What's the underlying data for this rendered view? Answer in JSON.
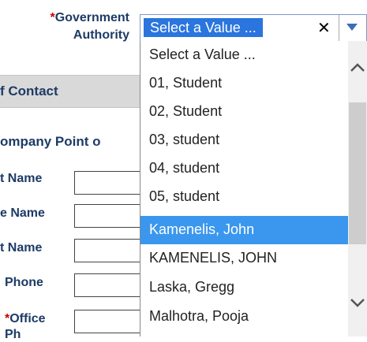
{
  "form": {
    "gov_label_req": "*",
    "gov_label_line1": "Government",
    "gov_label_line2": "Authority",
    "section_title": "f Contact",
    "subsection_title": "ompany Point o",
    "labels": {
      "first_name": "t Name",
      "middle_name": "e Name",
      "last_name": "t Name",
      "phone": "Phone",
      "office_req": "*",
      "office": "Office",
      "office_cut": "Ph"
    }
  },
  "select": {
    "value": "Select a Value ...",
    "clear_glyph": "✕",
    "options": [
      "Select a Value ...",
      "01, Student",
      "02, Student",
      "03, student",
      "04, student",
      "05, student",
      "Kamenelis, John",
      "KAMENELIS, JOHN",
      "Laska, Gregg",
      "Malhotra, Pooja"
    ],
    "highlighted_index": 6
  },
  "colors": {
    "label": "#1d3b66",
    "required": "#cc0000",
    "selected_bg": "#2a75de",
    "highlight_bg": "#3b97ee"
  }
}
